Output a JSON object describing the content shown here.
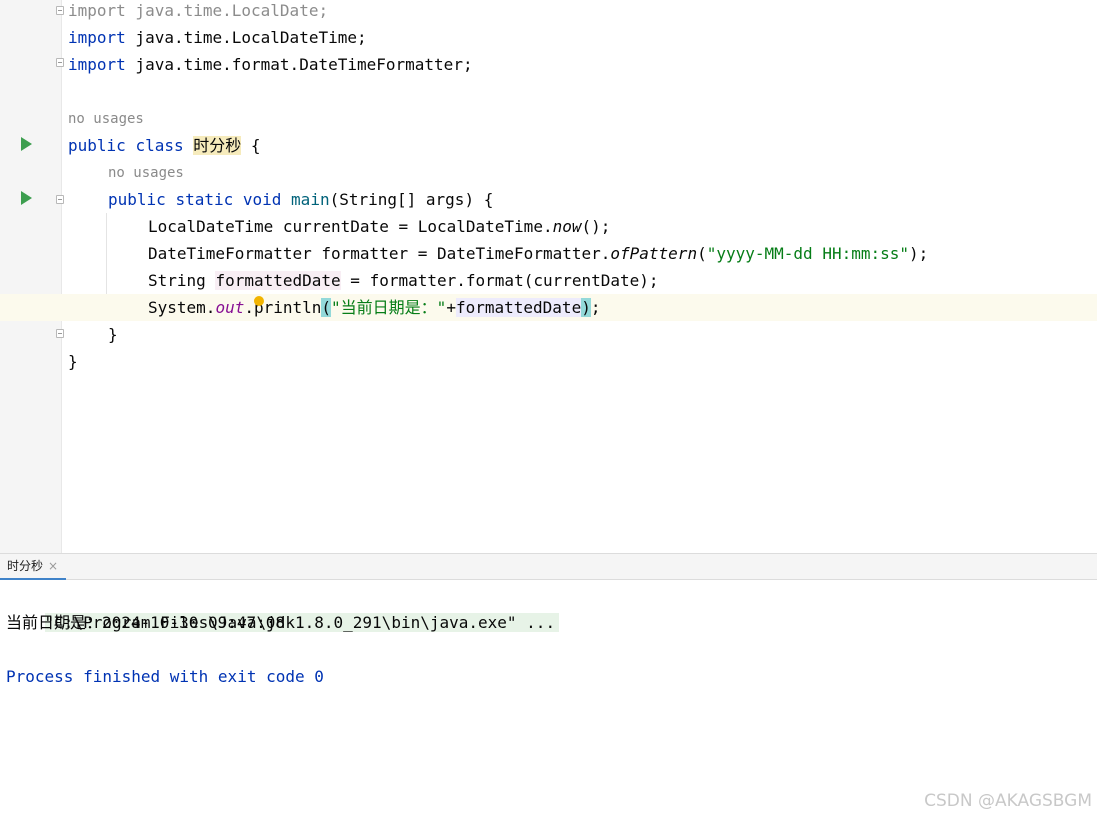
{
  "editor": {
    "lines": {
      "import1": {
        "kw": "import",
        "rest": " java.time.LocalDate;"
      },
      "import2": {
        "kw": "import",
        "rest": " java.time.LocalDateTime;"
      },
      "import3": {
        "kw": "import",
        "rest": " java.time.format.DateTimeFormatter;"
      },
      "hint_class": "no usages",
      "class_decl": {
        "kw1": "public",
        "kw2": "class",
        "name": "时分秒",
        "brace": "{"
      },
      "hint_main": "no usages",
      "main_decl": {
        "kw1": "public",
        "kw2": "static",
        "kw3": "void",
        "fn": "main",
        "params": "(String[] args) {"
      },
      "l1": {
        "a": "LocalDateTime currentDate = LocalDateTime.",
        "m": "now",
        "b": "();"
      },
      "l2": {
        "a": "DateTimeFormatter formatter = DateTimeFormatter.",
        "m": "ofPattern",
        "b": "(",
        "s": "\"yyyy-MM-dd HH:mm:ss\"",
        "c": ");"
      },
      "l3": {
        "a": "String ",
        "v": "formattedDate",
        "b": " = formatter.format(currentDate);"
      },
      "l4": {
        "a": "System.",
        "f": "out",
        "b": ".println",
        "p1": "(",
        "s": "\"当前日期是：\"",
        "plus": "+",
        "v": "formattedDate",
        "p2": ")",
        "end": ";"
      },
      "close_main": "}",
      "close_class": "}"
    }
  },
  "run_panel": {
    "tab_label": "时分秒",
    "tab_close": "×",
    "console": {
      "command": "\"C:\\Program Files\\Java\\jdk1.8.0_291\\bin\\java.exe\" ...",
      "output": "当前日期是：2024-10-30 09:47:08",
      "exit": "Process finished with exit code 0"
    }
  },
  "watermark": "CSDN @AKAGSBGM"
}
